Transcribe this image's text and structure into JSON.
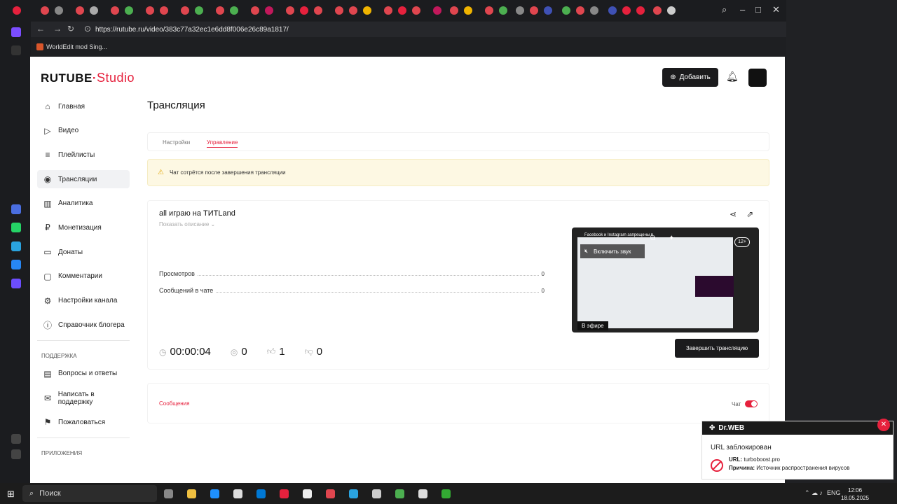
{
  "browser": {
    "url": "https://rutube.ru/video/383c77a32ec1e6dd8f006e26c89a1817/",
    "bookmark": "WorldEdit mod Sing..."
  },
  "header": {
    "logo_main": "RUTUBE",
    "logo_studio": "Studio",
    "add_label": "Добавить"
  },
  "sidebar": {
    "items": [
      {
        "label": "Главная",
        "icon": "home-icon"
      },
      {
        "label": "Видео",
        "icon": "video-icon"
      },
      {
        "label": "Плейлисты",
        "icon": "playlist-icon"
      },
      {
        "label": "Трансляции",
        "icon": "broadcast-icon"
      },
      {
        "label": "Аналитика",
        "icon": "analytics-icon"
      },
      {
        "label": "Монетизация",
        "icon": "monetization-icon"
      },
      {
        "label": "Донаты",
        "icon": "donate-icon"
      },
      {
        "label": "Комментарии",
        "icon": "comments-icon"
      },
      {
        "label": "Настройки канала",
        "icon": "gear-icon"
      },
      {
        "label": "Справочник блогера",
        "icon": "info-icon"
      }
    ],
    "support_heading": "ПОДДЕРЖКА",
    "support_items": [
      {
        "label": "Вопросы и ответы",
        "icon": "faq-icon"
      },
      {
        "label": "Написать в поддержку",
        "icon": "mail-icon"
      },
      {
        "label": "Пожаловаться",
        "icon": "flag-icon"
      }
    ],
    "apps_heading": "ПРИЛОЖЕНИЯ"
  },
  "main": {
    "title": "Трансляция",
    "tabs": [
      {
        "label": "Настройки"
      },
      {
        "label": "Управление"
      }
    ],
    "notice": "Чат сотрётся после завершения трансляции",
    "stream": {
      "title": "all играю на ТИТLand",
      "show_description": "Показать описание",
      "stats": [
        {
          "label": "Просмотров",
          "value": "0"
        },
        {
          "label": "Сообщений в чате",
          "value": "0"
        }
      ],
      "duration": "00:00:04",
      "viewers": "0",
      "likes": "1",
      "dislikes": "0",
      "preview_caption": "Facebook и Instagram запрещены в",
      "sound_label": "Включить звук",
      "age_rating": "12+",
      "live_label": "В эфире",
      "end_label": "Завершить трансляцию"
    },
    "messages_tab": "Сообщения",
    "chat_label": "Чат"
  },
  "drweb": {
    "brand": "Dr.WEB",
    "title": "URL заблокирован",
    "url_label": "URL:",
    "url_value": "turboboost.pro",
    "reason_label": "Причина:",
    "reason_value": "Источник распространения вирусов"
  },
  "taskbar": {
    "search_placeholder": "Поиск",
    "lang": "ENG",
    "time": "12:06",
    "date": "18.05.2025"
  }
}
